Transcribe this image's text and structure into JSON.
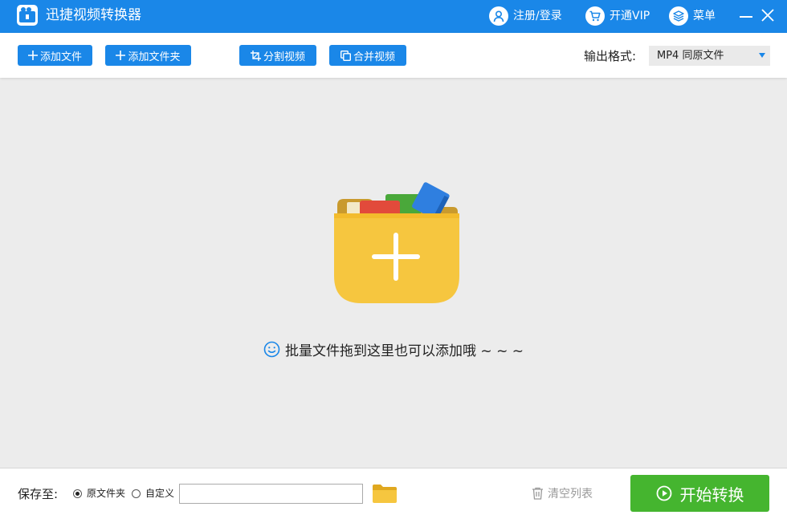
{
  "app": {
    "title": "迅捷视频转换器"
  },
  "titlebar": {
    "login_label": "注册/登录",
    "vip_label": "开通VIP",
    "menu_label": "菜单"
  },
  "toolbar": {
    "add_file": "添加文件",
    "add_folder": "添加文件夹",
    "split_video": "分割视频",
    "merge_video": "合并视频",
    "format_label": "输出格式:",
    "format_value": "MP4  同原文件"
  },
  "dropzone": {
    "hint": "批量文件拖到这里也可以添加哦 ~ ~ ~"
  },
  "bottom": {
    "save_to_label": "保存至:",
    "option_original": "原文件夹",
    "option_custom": "自定义",
    "selected_option": "原文件夹",
    "path_value": "",
    "clear_list": "清空列表",
    "start_convert": "开始转换"
  },
  "colors": {
    "primary": "#1a87e8",
    "start_green": "#45b52f",
    "folder_yellow": "#f6c63f",
    "background": "#ececec"
  },
  "icons": [
    "app-logo-icon",
    "user-icon",
    "cart-icon",
    "layers-icon",
    "minimize-icon",
    "close-icon",
    "plus-icon",
    "crop-icon",
    "merge-icon",
    "smile-icon",
    "folder-icon",
    "trash-icon",
    "play-circle-icon"
  ]
}
